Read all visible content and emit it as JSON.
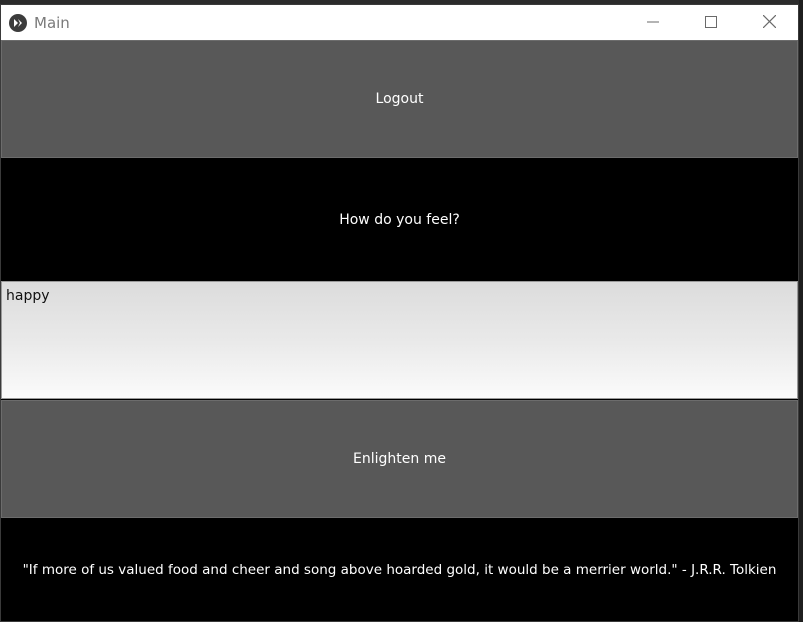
{
  "window": {
    "title": "Main",
    "controls": {
      "minimize": "minimize-icon",
      "maximize": "maximize-icon",
      "close": "close-icon"
    }
  },
  "main": {
    "logout_label": "Logout",
    "prompt_label": "How do you feel?",
    "feeling_input": {
      "value": "happy",
      "placeholder": ""
    },
    "enlighten_label": "Enlighten me",
    "quote_text": "\"If more of us valued food and cheer and song above hoarded gold, it would be a merrier world.\" - J.R.R. Tolkien"
  },
  "colors": {
    "button_bg": "#585858",
    "window_bg": "#000000",
    "text": "#ffffff",
    "titlebar_bg": "#ffffff"
  }
}
